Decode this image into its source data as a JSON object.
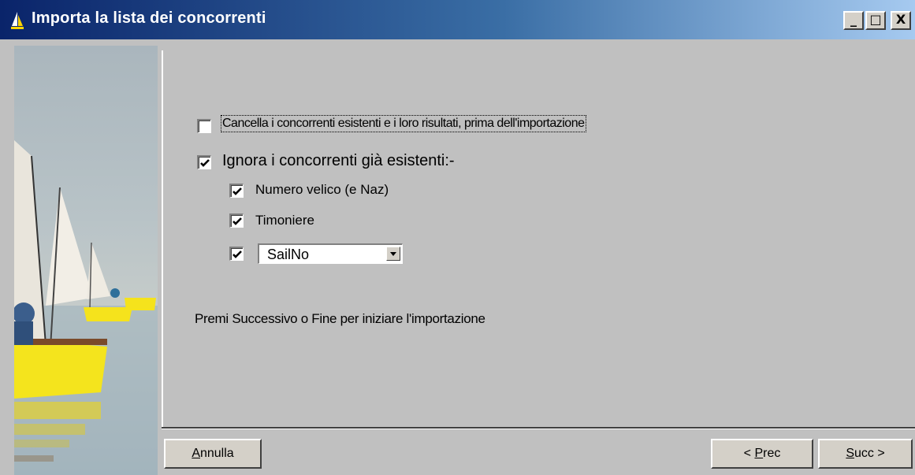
{
  "window": {
    "title": "Importa la lista dei concorrenti",
    "controls": {
      "minimize": "_",
      "maximize": "□",
      "close": "X"
    }
  },
  "options": {
    "clear_existing": {
      "checked": false,
      "label": "Cancella i concorrenti esistenti e i loro risultati, prima dell'importazione"
    },
    "ignore_existing": {
      "checked": true,
      "label": "Ignora i concorrenti già esistenti:-"
    },
    "sail_number": {
      "checked": true,
      "label": "Numero velico (e Naz)"
    },
    "helmsman": {
      "checked": true,
      "label": "Timoniere"
    },
    "custom_field": {
      "checked": true,
      "selected": "SailNo"
    }
  },
  "instruction": "Premi Successivo o Fine per iniziare l'importazione",
  "buttons": {
    "cancel": {
      "mnemonic": "A",
      "rest": "nnulla"
    },
    "prev": {
      "pre": "< ",
      "mnemonic": "P",
      "rest": "rec"
    },
    "next": {
      "mnemonic": "S",
      "rest": "ucc >"
    }
  },
  "icons": {
    "app": "sailboat-icon",
    "check": "checkmark-icon",
    "dropdown": "dropdown-arrow-icon"
  }
}
